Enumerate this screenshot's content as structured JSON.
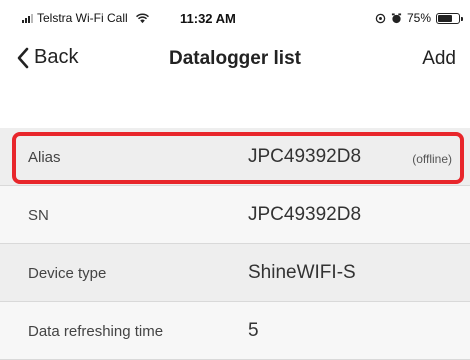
{
  "status_bar": {
    "carrier": "Telstra Wi-Fi Call",
    "time": "11:32 AM",
    "battery_percent": "75%",
    "battery_level": 0.75,
    "icons": [
      "signal-icon",
      "wifi-icon",
      "location-icon",
      "alarm-icon",
      "battery-icon"
    ]
  },
  "nav": {
    "back_label": "Back",
    "title": "Datalogger list",
    "add_label": "Add"
  },
  "rows": [
    {
      "label": "Alias",
      "value": "JPC49392D8",
      "extra": "(offline)"
    },
    {
      "label": "SN",
      "value": "JPC49392D8",
      "extra": ""
    },
    {
      "label": "Device type",
      "value": "ShineWIFI-S",
      "extra": ""
    },
    {
      "label": "Data refreshing time",
      "value": "5",
      "extra": ""
    }
  ],
  "colors": {
    "highlight": "#e8262b",
    "row_bg": "#eeeeee",
    "row_bg_alt": "#f7f7f7"
  }
}
